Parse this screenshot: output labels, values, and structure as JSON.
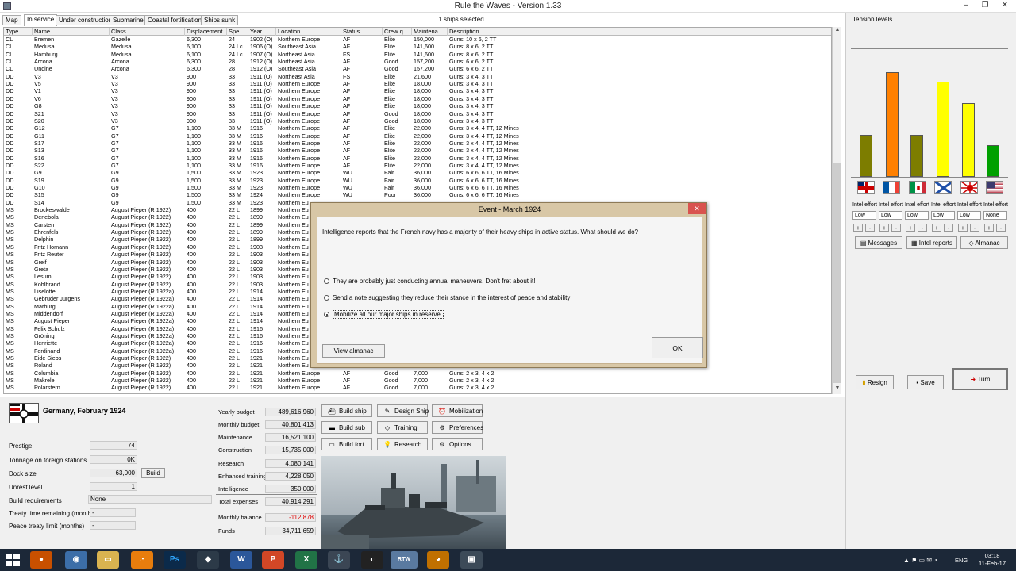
{
  "window": {
    "title": "Rule the Waves - Version 1.33",
    "minimize": "–",
    "restore": "❐",
    "close": "✕"
  },
  "tabs": [
    {
      "label": "Map"
    },
    {
      "label": "In service",
      "active": true
    },
    {
      "label": "Under construction"
    },
    {
      "label": "Submarines"
    },
    {
      "label": "Coastal fortifications"
    },
    {
      "label": "Ships sunk"
    }
  ],
  "selection": "1 ships selected",
  "columns": [
    "Type",
    "Name",
    "Class",
    "Displacement",
    "Spe...",
    "Year",
    "Location",
    "Status",
    "Crew q...",
    "Maintena...",
    "Description"
  ],
  "ships": [
    [
      "CL",
      "Bremen",
      "Gazelle",
      "6,300",
      "24",
      "1902 (O)",
      "Northern Europe",
      "AF",
      "Elite",
      "150,000",
      "Guns: 10 x 6, 2 TT"
    ],
    [
      "CL",
      "Medusa",
      "Medusa",
      "6,100",
      "24 Lc",
      "1906 (O)",
      "Southeast Asia",
      "AF",
      "Elite",
      "141,600",
      "Guns: 8 x 6, 2 TT"
    ],
    [
      "CL",
      "Hamburg",
      "Medusa",
      "6,100",
      "24 Lc",
      "1907 (O)",
      "Northeast Asia",
      "FS",
      "Elite",
      "141,600",
      "Guns: 8 x 6, 2 TT"
    ],
    [
      "CL",
      "Arcona",
      "Arcona",
      "6,300",
      "28",
      "1912 (O)",
      "Northeast Asia",
      "AF",
      "Good",
      "157,200",
      "Guns: 6 x 6, 2 TT"
    ],
    [
      "CL",
      "Undine",
      "Arcona",
      "6,300",
      "28",
      "1912 (O)",
      "Southeast Asia",
      "AF",
      "Good",
      "157,200",
      "Guns: 6 x 6, 2 TT"
    ],
    [
      "DD",
      "V3",
      "V3",
      "900",
      "33",
      "1911 (O)",
      "Northeast Asia",
      "FS",
      "Elite",
      "21,600",
      "Guns: 3 x 4, 3 TT"
    ],
    [
      "DD",
      "V5",
      "V3",
      "900",
      "33",
      "1911 (O)",
      "Northern Europe",
      "AF",
      "Elite",
      "18,000",
      "Guns: 3 x 4, 3 TT"
    ],
    [
      "DD",
      "V1",
      "V3",
      "900",
      "33",
      "1911 (O)",
      "Northern Europe",
      "AF",
      "Elite",
      "18,000",
      "Guns: 3 x 4, 3 TT"
    ],
    [
      "DD",
      "V6",
      "V3",
      "900",
      "33",
      "1911 (O)",
      "Northern Europe",
      "AF",
      "Elite",
      "18,000",
      "Guns: 3 x 4, 3 TT"
    ],
    [
      "DD",
      "G8",
      "V3",
      "900",
      "33",
      "1911 (O)",
      "Northern Europe",
      "AF",
      "Elite",
      "18,000",
      "Guns: 3 x 4, 3 TT"
    ],
    [
      "DD",
      "S21",
      "V3",
      "900",
      "33",
      "1911 (O)",
      "Northern Europe",
      "AF",
      "Good",
      "18,000",
      "Guns: 3 x 4, 3 TT"
    ],
    [
      "DD",
      "S20",
      "V3",
      "900",
      "33",
      "1911 (O)",
      "Northern Europe",
      "AF",
      "Good",
      "18,000",
      "Guns: 3 x 4, 3 TT"
    ],
    [
      "DD",
      "G12",
      "G7",
      "1,100",
      "33 M",
      "1916",
      "Northern Europe",
      "AF",
      "Elite",
      "22,000",
      "Guns: 3 x 4, 4 TT, 12 Mines"
    ],
    [
      "DD",
      "G11",
      "G7",
      "1,100",
      "33 M",
      "1916",
      "Northern Europe",
      "AF",
      "Elite",
      "22,000",
      "Guns: 3 x 4, 4 TT, 12 Mines"
    ],
    [
      "DD",
      "S17",
      "G7",
      "1,100",
      "33 M",
      "1916",
      "Northern Europe",
      "AF",
      "Elite",
      "22,000",
      "Guns: 3 x 4, 4 TT, 12 Mines"
    ],
    [
      "DD",
      "S13",
      "G7",
      "1,100",
      "33 M",
      "1916",
      "Northern Europe",
      "AF",
      "Elite",
      "22,000",
      "Guns: 3 x 4, 4 TT, 12 Mines"
    ],
    [
      "DD",
      "S16",
      "G7",
      "1,100",
      "33 M",
      "1916",
      "Northern Europe",
      "AF",
      "Elite",
      "22,000",
      "Guns: 3 x 4, 4 TT, 12 Mines"
    ],
    [
      "DD",
      "S22",
      "G7",
      "1,100",
      "33 M",
      "1916",
      "Northern Europe",
      "AF",
      "Elite",
      "22,000",
      "Guns: 3 x 4, 4 TT, 12 Mines"
    ],
    [
      "DD",
      "G9",
      "G9",
      "1,500",
      "33 M",
      "1923",
      "Northern Europe",
      "WU",
      "Fair",
      "36,000",
      "Guns: 6 x 6, 6 TT, 16 Mines"
    ],
    [
      "DD",
      "S19",
      "G9",
      "1,500",
      "33 M",
      "1923",
      "Northern Europe",
      "WU",
      "Fair",
      "36,000",
      "Guns: 6 x 6, 6 TT, 16 Mines"
    ],
    [
      "DD",
      "G10",
      "G9",
      "1,500",
      "33 M",
      "1923",
      "Northern Europe",
      "WU",
      "Fair",
      "36,000",
      "Guns: 6 x 6, 6 TT, 16 Mines"
    ],
    [
      "DD",
      "S15",
      "G9",
      "1,500",
      "33 M",
      "1924",
      "Northern Europe",
      "WU",
      "Poor",
      "36,000",
      "Guns: 6 x 6, 6 TT, 16 Mines"
    ],
    [
      "DD",
      "S14",
      "G9",
      "1,500",
      "33 M",
      "1923",
      "Northern Eu",
      "",
      "",
      "",
      ""
    ],
    [
      "MS",
      "Brockeswalde",
      "August Pieper (R 1922)",
      "400",
      "22 L",
      "1899",
      "Northern Eu",
      "",
      "",
      "",
      ""
    ],
    [
      "MS",
      "Denebola",
      "August Pieper (R 1922)",
      "400",
      "22 L",
      "1899",
      "Northern Eu",
      "",
      "",
      "",
      ""
    ],
    [
      "MS",
      "Carsten",
      "August Pieper (R 1922)",
      "400",
      "22 L",
      "1899",
      "Northern Eu",
      "",
      "",
      "",
      ""
    ],
    [
      "MS",
      "Ehrenfels",
      "August Pieper (R 1922)",
      "400",
      "22 L",
      "1899",
      "Northern Eu",
      "",
      "",
      "",
      ""
    ],
    [
      "MS",
      "Delphin",
      "August Pieper (R 1922)",
      "400",
      "22 L",
      "1899",
      "Northern Eu",
      "",
      "",
      "",
      ""
    ],
    [
      "MS",
      "Fritz Homann",
      "August Pieper (R 1922)",
      "400",
      "22 L",
      "1903",
      "Northern Eu",
      "",
      "",
      "",
      ""
    ],
    [
      "MS",
      "Fritz Reuter",
      "August Pieper (R 1922)",
      "400",
      "22 L",
      "1903",
      "Northern Eu",
      "",
      "",
      "",
      ""
    ],
    [
      "MS",
      "Greif",
      "August Pieper (R 1922)",
      "400",
      "22 L",
      "1903",
      "Northern Eu",
      "",
      "",
      "",
      ""
    ],
    [
      "MS",
      "Greta",
      "August Pieper (R 1922)",
      "400",
      "22 L",
      "1903",
      "Northern Eu",
      "",
      "",
      "",
      ""
    ],
    [
      "MS",
      "Lesum",
      "August Pieper (R 1922)",
      "400",
      "22 L",
      "1903",
      "Northern Eu",
      "",
      "",
      "",
      ""
    ],
    [
      "MS",
      "Kohlbrand",
      "August Pieper (R 1922)",
      "400",
      "22 L",
      "1903",
      "Northern Eu",
      "",
      "",
      "",
      ""
    ],
    [
      "MS",
      "Liselotte",
      "August Pieper (R 1922a)",
      "400",
      "22 L",
      "1914",
      "Northern Eu",
      "",
      "",
      "",
      ""
    ],
    [
      "MS",
      "Gebrüder Jurgens",
      "August Pieper (R 1922a)",
      "400",
      "22 L",
      "1914",
      "Northern Eu",
      "",
      "",
      "",
      ""
    ],
    [
      "MS",
      "Marburg",
      "August Pieper (R 1922a)",
      "400",
      "22 L",
      "1914",
      "Northern Eu",
      "",
      "",
      "",
      ""
    ],
    [
      "MS",
      "Middendorf",
      "August Pieper (R 1922a)",
      "400",
      "22 L",
      "1914",
      "Northern Eu",
      "",
      "",
      "",
      ""
    ],
    [
      "MS",
      "August Pieper",
      "August Pieper (R 1922a)",
      "400",
      "22 L",
      "1914",
      "Northern Eu",
      "",
      "",
      "",
      ""
    ],
    [
      "MS",
      "Felix Schulz",
      "August Pieper (R 1922a)",
      "400",
      "22 L",
      "1916",
      "Northern Eu",
      "",
      "",
      "",
      ""
    ],
    [
      "MS",
      "Gröning",
      "August Pieper (R 1922a)",
      "400",
      "22 L",
      "1916",
      "Northern Eu",
      "",
      "",
      "",
      ""
    ],
    [
      "MS",
      "Henriette",
      "August Pieper (R 1922a)",
      "400",
      "22 L",
      "1916",
      "Northern Eu",
      "",
      "",
      "",
      ""
    ],
    [
      "MS",
      "Ferdinand",
      "August Pieper (R 1922a)",
      "400",
      "22 L",
      "1916",
      "Northern Eu",
      "",
      "",
      "",
      ""
    ],
    [
      "MS",
      "Eide Siebs",
      "August Pieper (R 1922)",
      "400",
      "22 L",
      "1921",
      "Northern Eu",
      "",
      "",
      "",
      ""
    ],
    [
      "MS",
      "Roland",
      "August Pieper (R 1922)",
      "400",
      "22 L",
      "1921",
      "Northern Eu",
      "",
      "",
      "",
      ""
    ],
    [
      "MS",
      "Columbia",
      "August Pieper (R 1922)",
      "400",
      "22 L",
      "1921",
      "Northern Europe",
      "AF",
      "Good",
      "7,000",
      "Guns: 2 x 3, 4 x 2"
    ],
    [
      "MS",
      "Makrele",
      "August Pieper (R 1922)",
      "400",
      "22 L",
      "1921",
      "Northern Europe",
      "AF",
      "Good",
      "7,000",
      "Guns: 2 x 3, 4 x 2"
    ],
    [
      "MS",
      "Polarstern",
      "August Pieper (R 1922)",
      "400",
      "22 L",
      "1921",
      "Northern Europe",
      "AF",
      "Good",
      "7,000",
      "Guns: 2 x 3, 4 x 2"
    ]
  ],
  "dialog": {
    "title": "Event - March 1924",
    "close": "✕",
    "message": "Intelligence reports that the French navy has a majority of their heavy ships in active status. What should we do?",
    "options": [
      {
        "label": "They are probably just conducting annual maneuvers. Don't fret about it!",
        "selected": false
      },
      {
        "label": "Send a note suggesting they reduce their stance in the interest of peace and stability",
        "selected": false
      },
      {
        "label": "Mobilize all our major ships in reserve.",
        "selected": true
      }
    ],
    "almanac_button": "View almanac",
    "ok_button": "OK"
  },
  "nation": {
    "title": "Germany, February 1924"
  },
  "stats": [
    {
      "label": "Prestige",
      "value": "74"
    },
    {
      "label": "Tonnage on foreign stations",
      "value": "0K"
    },
    {
      "label": "Dock size",
      "value": "63,000"
    },
    {
      "label": "Unrest level",
      "value": "1"
    },
    {
      "label": "Build requirements",
      "value": "None"
    },
    {
      "label": "Treaty time remaining (months)",
      "value": "-"
    },
    {
      "label": "Peace treaty limit (months)",
      "value": "-"
    }
  ],
  "dock_build_button": "Build",
  "finances": [
    {
      "label": "Yearly budget",
      "value": "489,616,960"
    },
    {
      "label": "Monthly budget",
      "value": "40,801,413"
    },
    {
      "label": "Maintenance",
      "value": "16,521,100"
    },
    {
      "label": "Construction",
      "value": "15,735,000"
    },
    {
      "label": "Research",
      "value": "4,080,141"
    },
    {
      "label": "Enhanced training",
      "value": "4,228,050"
    },
    {
      "label": "Intelligence",
      "value": "350,000"
    },
    {
      "label": "Total expenses",
      "value": "40,914,291"
    },
    {
      "label": "Monthly balance",
      "value": "-112,878",
      "negative": true
    },
    {
      "label": "Funds",
      "value": "34,711,659"
    }
  ],
  "commands": [
    {
      "label": "Build ship",
      "icon": "⛴"
    },
    {
      "label": "Design Ship",
      "icon": "✎"
    },
    {
      "label": "Mobilization",
      "icon": "⏰"
    },
    {
      "label": "Build sub",
      "icon": "▬"
    },
    {
      "label": "Training",
      "icon": "◇"
    },
    {
      "label": "Preferences",
      "icon": "⚙"
    },
    {
      "label": "Build fort",
      "icon": "▭"
    },
    {
      "label": "Research",
      "icon": "💡"
    },
    {
      "label": "Options",
      "icon": "⚙"
    }
  ],
  "tension": {
    "title": "Tension levels",
    "max": 10,
    "nations": [
      {
        "flag": "UK",
        "level": 4.0,
        "color": "#7d7d00",
        "effort": "Low"
      },
      {
        "flag": "France",
        "level": 9.9,
        "color": "#ff8000",
        "effort": "Low"
      },
      {
        "flag": "Italy",
        "level": 4.0,
        "color": "#7d7d00",
        "effort": "Low"
      },
      {
        "flag": "Russia",
        "level": 9.0,
        "color": "#ffff00",
        "effort": "Low"
      },
      {
        "flag": "Japan",
        "level": 7.0,
        "color": "#ffff00",
        "effort": "Low"
      },
      {
        "flag": "USA",
        "level": 3.0,
        "color": "#00a000",
        "effort": "None"
      }
    ],
    "effort_label": "Intel effort",
    "plus": "+",
    "minus": "-"
  },
  "right_buttons": {
    "messages": "Messages",
    "intel": "Intel reports",
    "almanac": "Almanac",
    "resign": "Resign",
    "save": "Save",
    "turn": "Turn"
  },
  "taskbar": {
    "time": "03:18",
    "date": "11-Feb-17",
    "lang": "ENG"
  }
}
